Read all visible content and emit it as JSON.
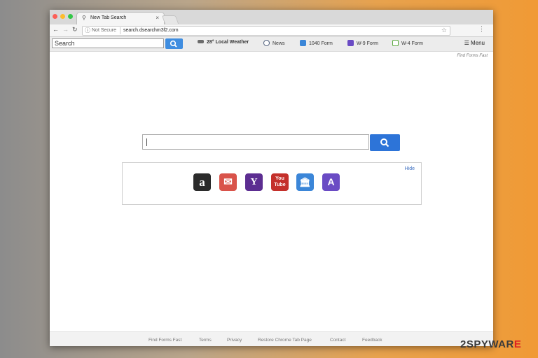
{
  "browser": {
    "tab_title": "New Tab Search",
    "security_label": "Not Secure",
    "url": "search.dsearchm3f2.com"
  },
  "extension_bar": {
    "search_placeholder": "Search",
    "items": [
      {
        "label": "28° Local Weather",
        "icon": "weather-icon",
        "color": "#6b6b6b"
      },
      {
        "label": "News",
        "icon": "news-icon",
        "color": "#4a5a78"
      },
      {
        "label": "1040 Form",
        "icon": "building-icon",
        "color": "#3b86d8"
      },
      {
        "label": "W-9 Form",
        "icon": "letter-a-icon",
        "color": "#6a4bc4"
      },
      {
        "label": "W-4 Form",
        "icon": "document-icon",
        "color": "#5aa83e"
      }
    ],
    "menu_label": "Menu"
  },
  "find_forms_top": "Find Forms Fast",
  "quick_links": {
    "hide_label": "Hide",
    "tiles": [
      {
        "name": "amazon-icon",
        "glyph": "a",
        "color": "#2b2b2b"
      },
      {
        "name": "mail-icon",
        "glyph": "✉",
        "color": "#d9534a"
      },
      {
        "name": "yahoo-icon",
        "glyph": "Y",
        "color": "#5c2d91"
      },
      {
        "name": "youtube-icon",
        "glyph": "You Tube",
        "color": "#c4302b"
      },
      {
        "name": "bank-icon",
        "glyph": "🏛",
        "color": "#3b86d8"
      },
      {
        "name": "letter-a-icon",
        "glyph": "A",
        "color": "#6a4bc4"
      }
    ]
  },
  "footer": {
    "links": [
      "Find Forms Fast",
      "Terms",
      "Privacy",
      "Restore Chrome Tab Page",
      "Contact",
      "Feedback"
    ]
  },
  "watermark": {
    "prefix": "2SPYWAR",
    "accent": "E"
  }
}
